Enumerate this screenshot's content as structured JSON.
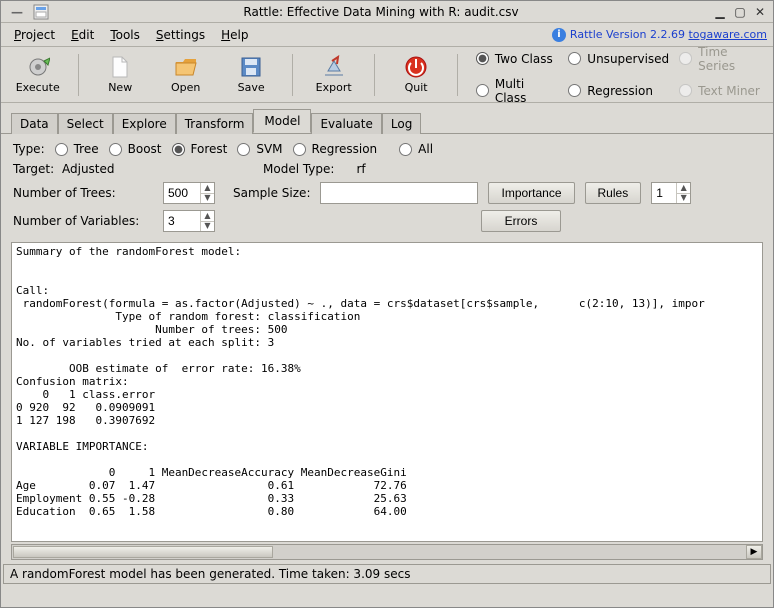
{
  "window": {
    "title": "Rattle: Effective Data Mining with R: audit.csv",
    "minimize": "_",
    "maximize": "□",
    "close": "×"
  },
  "menu": {
    "project": "Project",
    "edit": "Edit",
    "tools": "Tools",
    "settings": "Settings",
    "help": "Help",
    "version_prefix": "Rattle Version 2.2.69 ",
    "version_link": "togaware.com"
  },
  "toolbar": {
    "execute": "Execute",
    "new": "New",
    "open": "Open",
    "save": "Save",
    "export": "Export",
    "quit": "Quit",
    "radios": {
      "two_class": "Two Class",
      "unsupervised": "Unsupervised",
      "time_series": "Time Series",
      "multi_class": "Multi Class",
      "regression": "Regression",
      "text_miner": "Text Miner"
    }
  },
  "tabs": [
    "Data",
    "Select",
    "Explore",
    "Transform",
    "Model",
    "Evaluate",
    "Log"
  ],
  "model": {
    "type_label": "Type:",
    "types": {
      "tree": "Tree",
      "boost": "Boost",
      "forest": "Forest",
      "svm": "SVM",
      "regression": "Regression",
      "all": "All"
    },
    "target_label": "Target:",
    "target_value": "Adjusted",
    "model_type_label": "Model Type:",
    "model_type_value": "rf",
    "num_trees_label": "Number of Trees:",
    "num_trees_value": "500",
    "sample_size_label": "Sample Size:",
    "sample_size_value": "",
    "importance_btn": "Importance",
    "rules_btn": "Rules",
    "rules_value": "1",
    "num_vars_label": "Number of Variables:",
    "num_vars_value": "3",
    "errors_btn": "Errors"
  },
  "output": "Summary of the randomForest model:\n\n\nCall:\n randomForest(formula = as.factor(Adjusted) ~ ., data = crs$dataset[crs$sample,      c(2:10, 13)], impor\n               Type of random forest: classification\n                     Number of trees: 500\nNo. of variables tried at each split: 3\n\n        OOB estimate of  error rate: 16.38%\nConfusion matrix:\n    0   1 class.error\n0 920  92   0.0909091\n1 127 198   0.3907692\n\nVARIABLE IMPORTANCE:\n\n              0     1 MeanDecreaseAccuracy MeanDecreaseGini\nAge        0.07  1.47                 0.61            72.76\nEmployment 0.55 -0.28                 0.33            25.63\nEducation  0.65  1.58                 0.80            64.00",
  "status": "A randomForest model has been generated. Time taken: 3.09 secs",
  "chart_data": {
    "type": "table",
    "title": "Random Forest Output",
    "forest": {
      "type": "classification",
      "ntree": 500,
      "mtry": 3,
      "oob_error_rate_pct": 16.38
    },
    "confusion_matrix": {
      "rows": [
        "0",
        "1"
      ],
      "cols": [
        "0",
        "1",
        "class.error"
      ],
      "data": [
        [
          920,
          92,
          0.0909091
        ],
        [
          127,
          198,
          0.3907692
        ]
      ]
    },
    "variable_importance": {
      "columns": [
        "Variable",
        "0",
        "1",
        "MeanDecreaseAccuracy",
        "MeanDecreaseGini"
      ],
      "rows": [
        [
          "Age",
          0.07,
          1.47,
          0.61,
          72.76
        ],
        [
          "Employment",
          0.55,
          -0.28,
          0.33,
          25.63
        ],
        [
          "Education",
          0.65,
          1.58,
          0.8,
          64.0
        ]
      ]
    }
  }
}
